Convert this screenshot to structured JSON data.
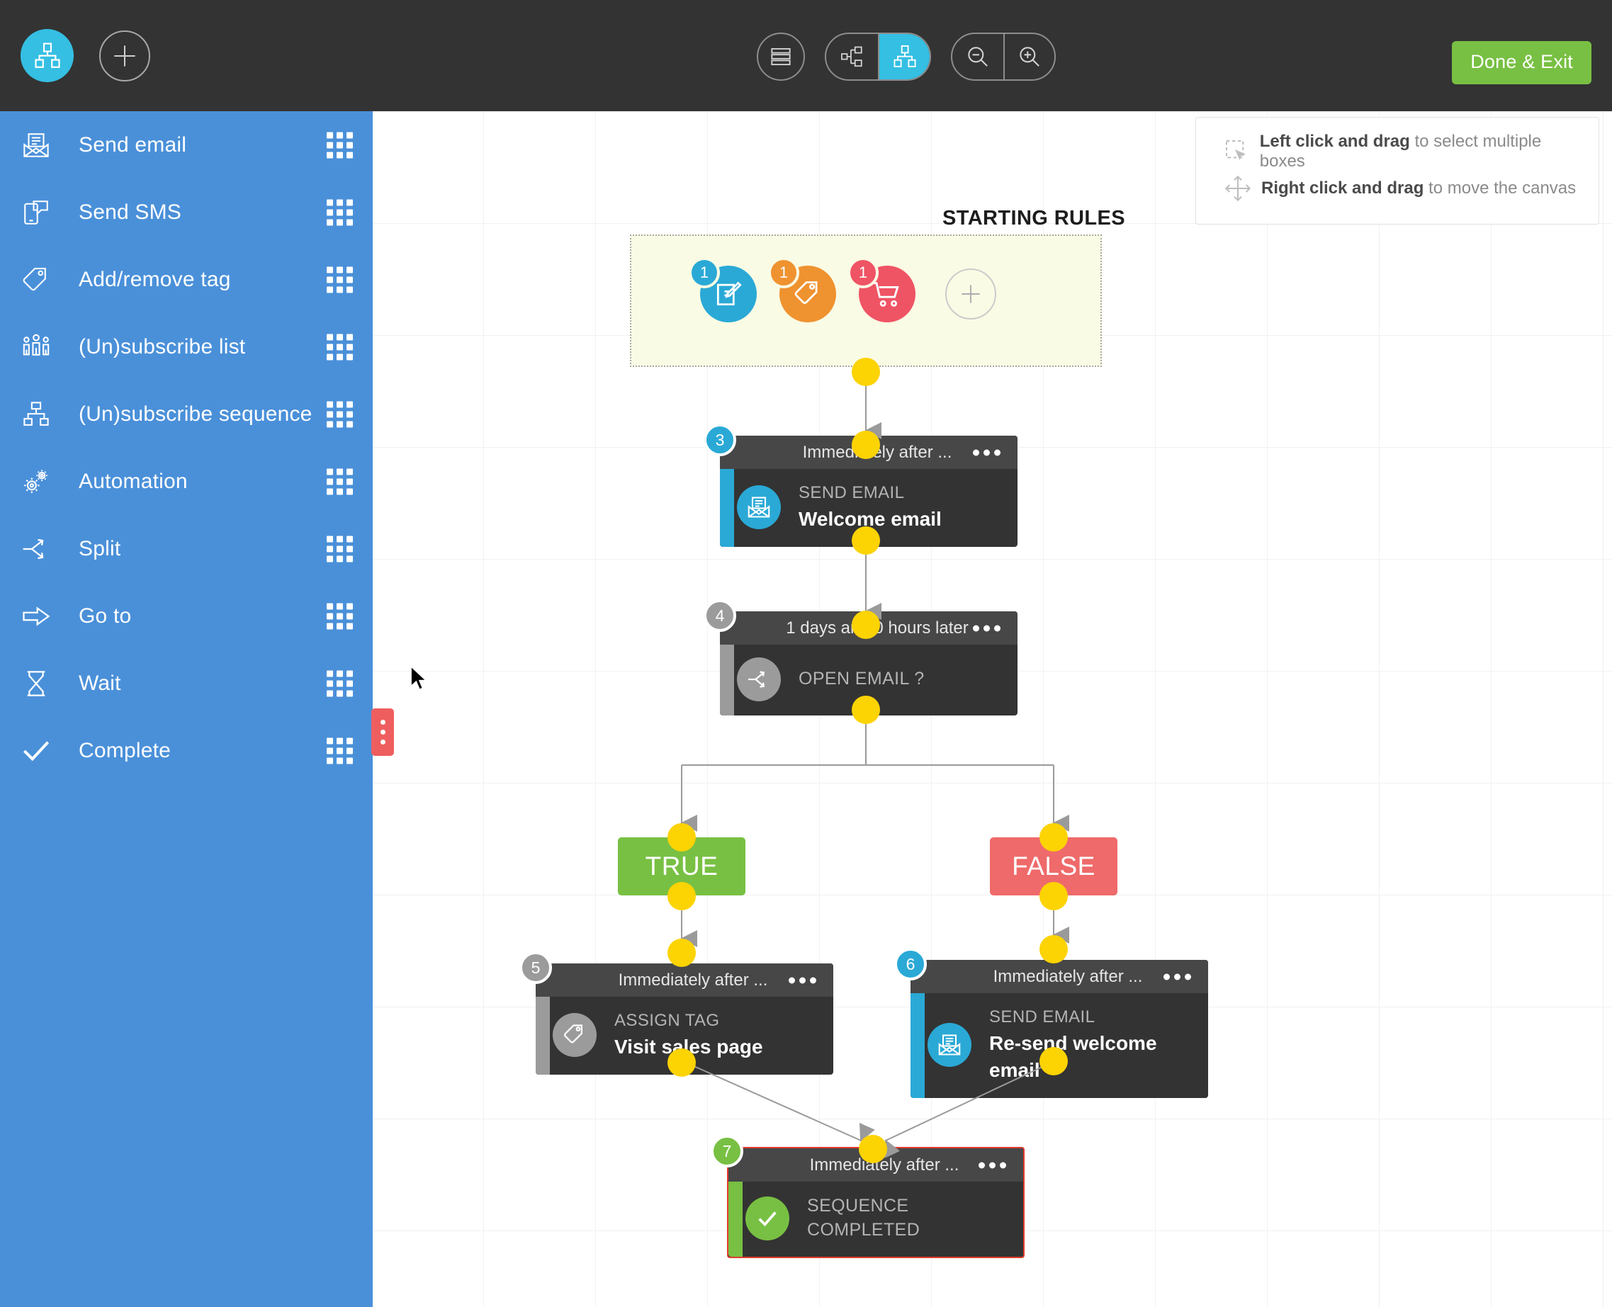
{
  "topbar": {
    "logo_icon": "sitemap-icon",
    "add_icon": "plus-icon",
    "tools": [
      {
        "name": "list-view-button",
        "icon": "list-icon",
        "active": false
      },
      {
        "name": "horizontal-layout-button",
        "icon": "sitemap-horizontal-icon",
        "active": false
      },
      {
        "name": "vertical-layout-button",
        "icon": "sitemap-vertical-icon",
        "active": true
      },
      {
        "name": "zoom-out-button",
        "icon": "magnifier-minus-icon",
        "active": false
      },
      {
        "name": "zoom-in-button",
        "icon": "magnifier-plus-icon",
        "active": false
      }
    ],
    "done_label": "Done & Exit"
  },
  "sidebar": {
    "items": [
      {
        "label": "Send email",
        "icon": "open-envelope-icon"
      },
      {
        "label": "Send SMS",
        "icon": "phone-chat-icon"
      },
      {
        "label": "Add/remove tag",
        "icon": "tag-icon"
      },
      {
        "label": "(Un)subscribe list",
        "icon": "people-group-icon"
      },
      {
        "label": "(Un)subscribe sequence",
        "icon": "sitemap-icon"
      },
      {
        "label": "Automation",
        "icon": "gears-icon"
      },
      {
        "label": "Split",
        "icon": "split-arrows-icon"
      },
      {
        "label": "Go to",
        "icon": "right-arrow-icon"
      },
      {
        "label": "Wait",
        "icon": "hourglass-icon"
      },
      {
        "label": "Complete",
        "icon": "checkmark-icon"
      }
    ]
  },
  "legend": {
    "rows": [
      {
        "icon": "marquee-select-icon",
        "bold": "Left click and drag",
        "rest": " to select multiple boxes"
      },
      {
        "icon": "move-arrows-icon",
        "bold": "Right click and drag",
        "rest": " to move the canvas"
      }
    ]
  },
  "starting_rules": {
    "title": "STARTING RULES",
    "rules": [
      {
        "icon": "form-pencil-icon",
        "count": "1",
        "color": "#2aa9d6"
      },
      {
        "icon": "tag-icon",
        "count": "1",
        "color": "#ef9230"
      },
      {
        "icon": "shopping-cart-icon",
        "count": "1",
        "color": "#ef5464"
      }
    ],
    "add_icon": "plus-icon"
  },
  "canvas": {
    "nodes": [
      {
        "number": "3",
        "header": "Immediately after ...",
        "kicker": "SEND EMAIL",
        "title": "Welcome email",
        "icon": "open-envelope-icon",
        "accent": "blue",
        "selected": false
      },
      {
        "number": "4",
        "header": "1 days and 0 hours later",
        "kicker": "OPEN EMAIL ?",
        "title": "",
        "icon": "split-arrows-icon",
        "accent": "grey",
        "selected": false
      },
      {
        "number": "5",
        "header": "Immediately after ...",
        "kicker": "ASSIGN TAG",
        "title": "Visit sales page",
        "icon": "tag-icon",
        "accent": "grey",
        "selected": false
      },
      {
        "number": "6",
        "header": "Immediately after ...",
        "kicker": "SEND EMAIL",
        "title": "Re-send welcome email",
        "icon": "open-envelope-icon",
        "accent": "blue",
        "selected": false
      },
      {
        "number": "7",
        "header": "Immediately after ...",
        "kicker": "SEQUENCE COMPLETED",
        "title": "",
        "icon": "checkmark-icon",
        "accent": "green",
        "selected": true
      }
    ],
    "branches": [
      {
        "label": "TRUE",
        "color": "#78c043"
      },
      {
        "label": "FALSE",
        "color": "#ef6a6a"
      }
    ]
  },
  "colors": {
    "brand_cyan": "#35bfe3",
    "sidebar_blue": "#4a90d9",
    "topbar_dark": "#333333",
    "node_dark": "#333333",
    "node_header": "#474747",
    "connector_yellow": "#fcd303",
    "true_green": "#78c043",
    "false_red": "#ef6a6a",
    "selected_red": "#e23a2e",
    "starting_rules_bg": "#fafbe4"
  }
}
